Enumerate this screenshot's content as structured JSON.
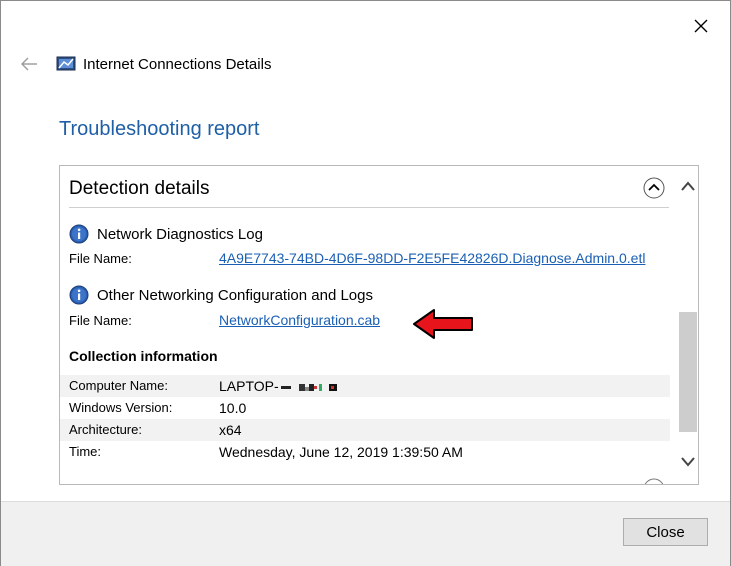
{
  "window": {
    "title": "Internet Connections Details",
    "close_icon": "close-icon",
    "back_icon": "back-arrow-icon"
  },
  "heading": "Troubleshooting report",
  "panel": {
    "title": "Detection details",
    "sections": [
      {
        "title": "Network Diagnostics Log",
        "field_label": "File Name:",
        "file_link": "4A9E7743-74BD-4D6F-98DD-F2E5FE42826D.Diagnose.Admin.0.etl"
      },
      {
        "title": "Other Networking Configuration and Logs",
        "field_label": "File Name:",
        "file_link": "NetworkConfiguration.cab"
      }
    ],
    "collection": {
      "title": "Collection information",
      "rows": [
        {
          "key": "Computer Name:",
          "value": "LAPTOP-"
        },
        {
          "key": "Windows Version:",
          "value": "10.0"
        },
        {
          "key": "Architecture:",
          "value": "x64"
        },
        {
          "key": "Time:",
          "value": "Wednesday, June 12, 2019 1:39:50 AM"
        }
      ]
    }
  },
  "footer": {
    "close_label": "Close"
  },
  "colors": {
    "heading": "#1f5fa6",
    "link": "#1a5fb4",
    "annotation_arrow": "#e8141c"
  }
}
